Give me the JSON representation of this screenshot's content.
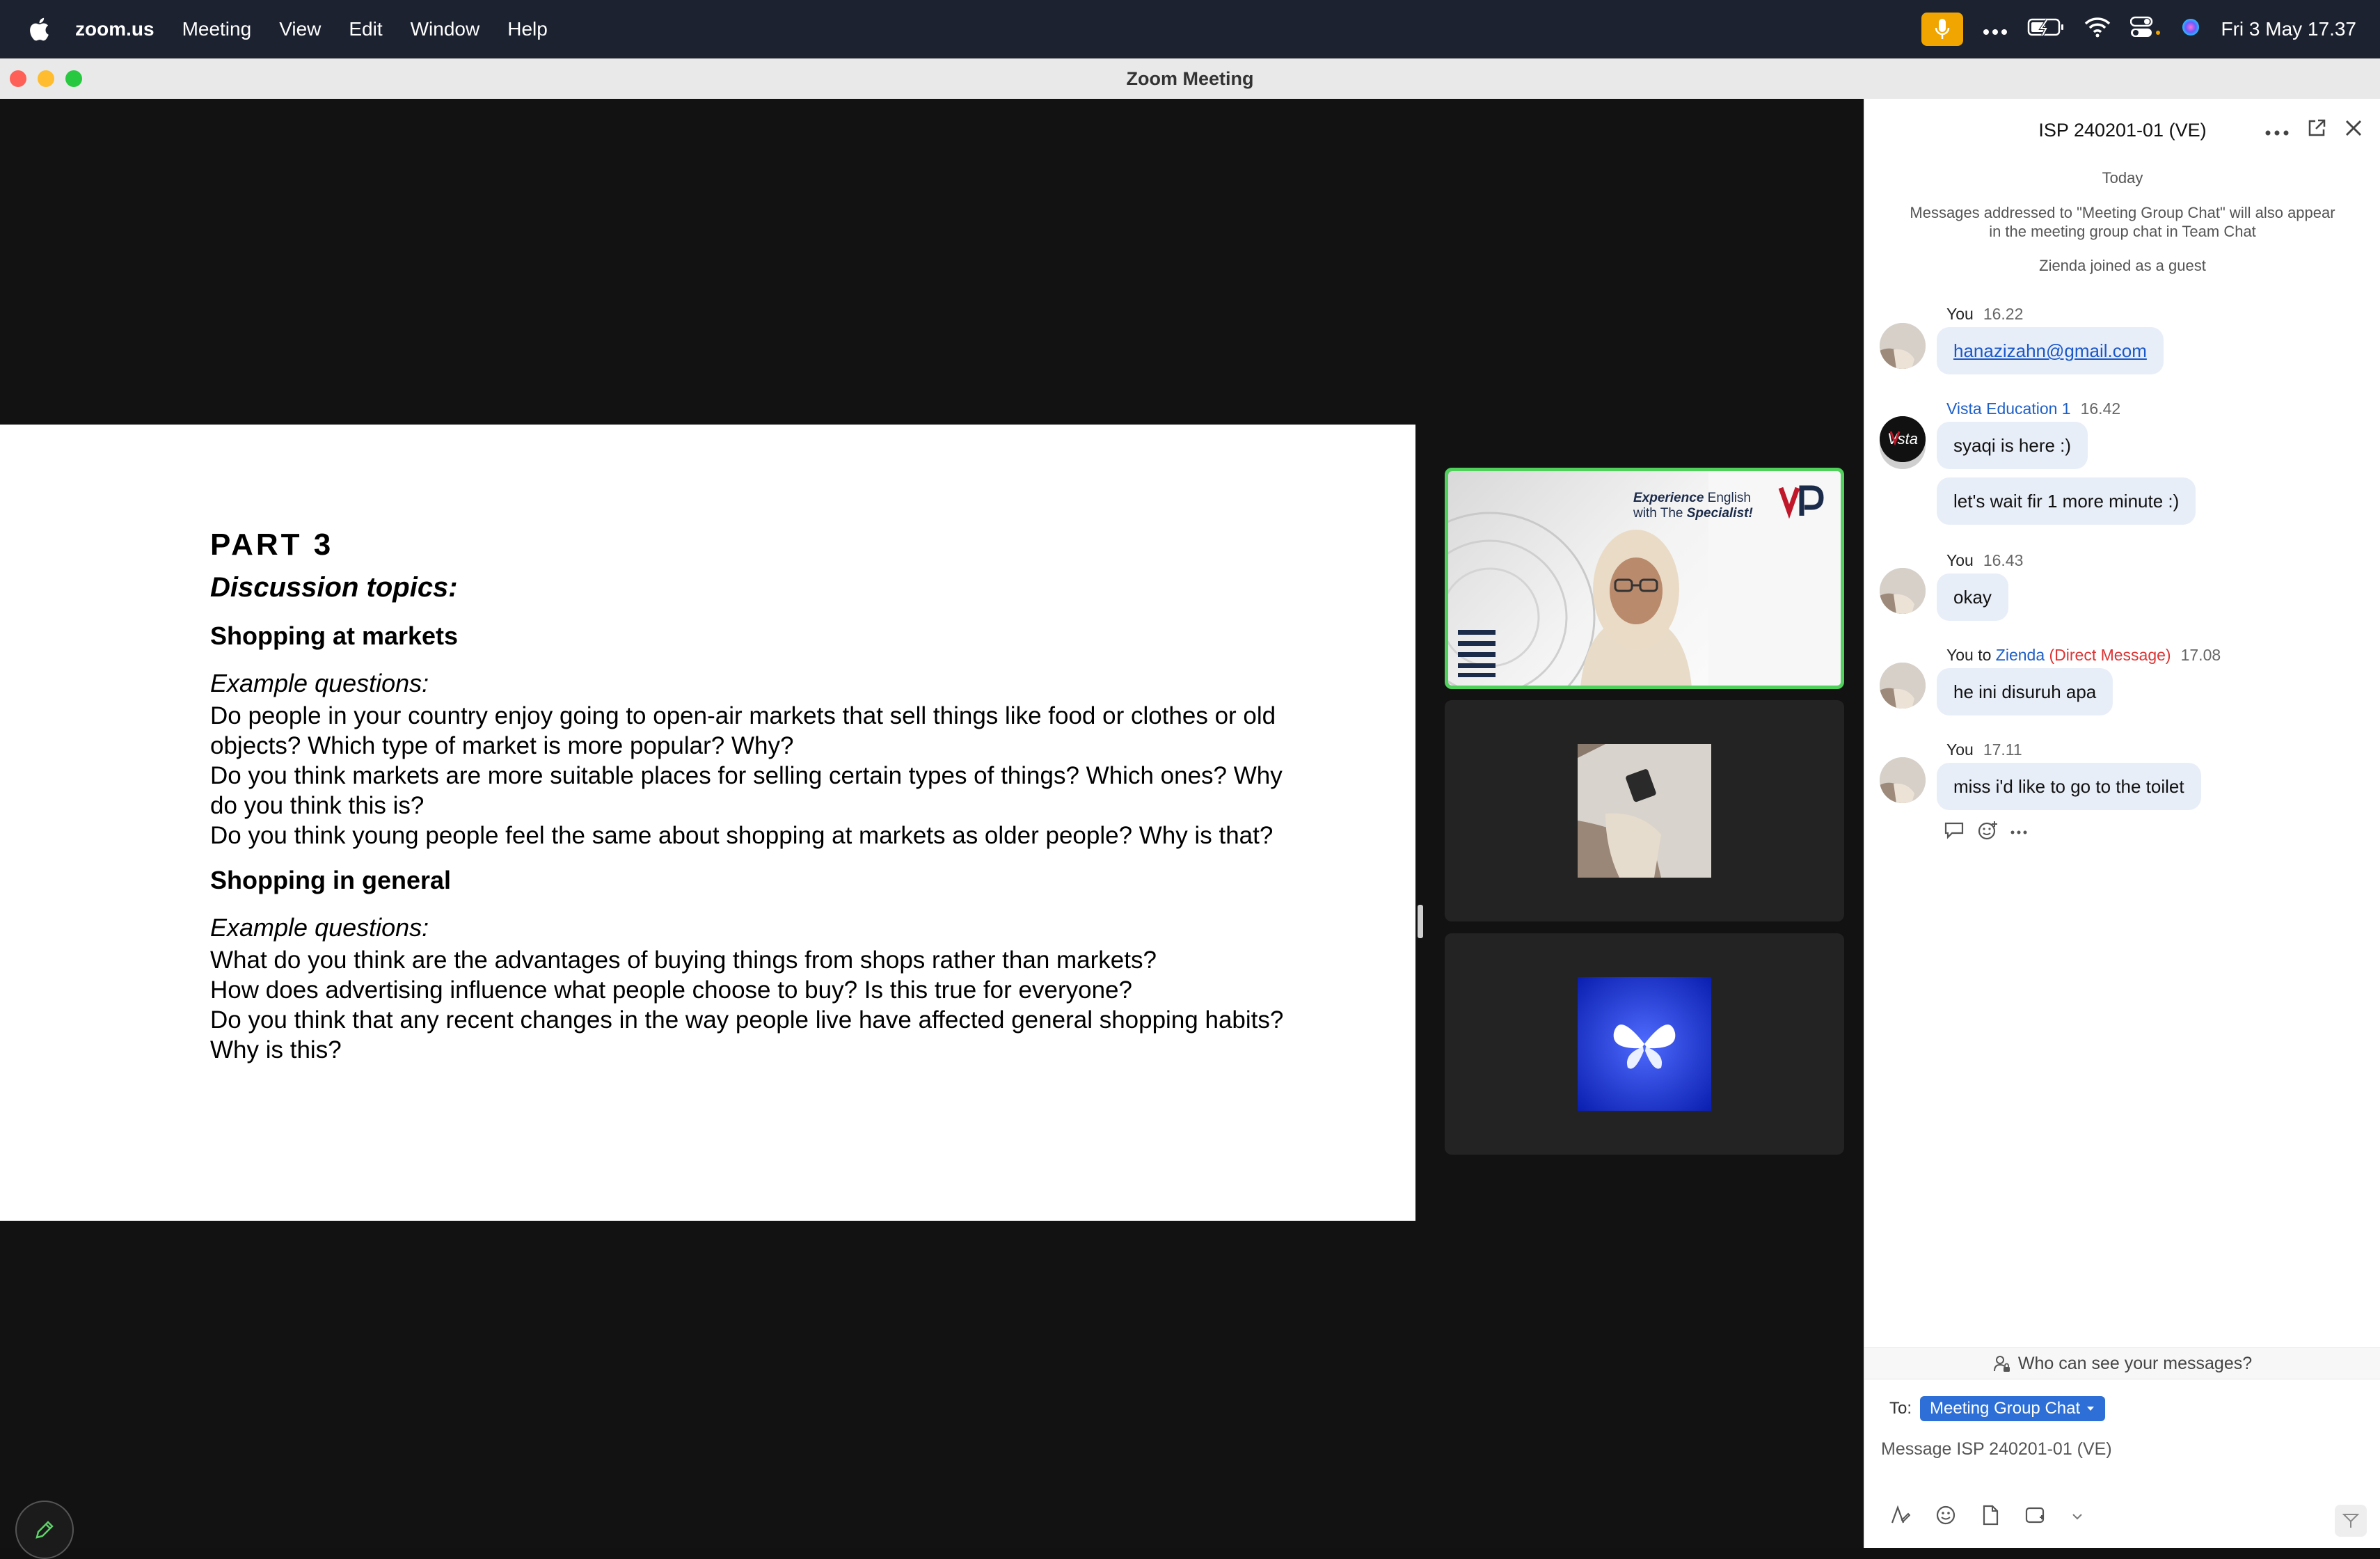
{
  "menubar": {
    "app_name": "zoom.us",
    "menus": [
      "Meeting",
      "View",
      "Edit",
      "Window",
      "Help"
    ],
    "clock": "Fri 3 May  17.37",
    "icons": [
      "apple-icon",
      "microphone-icon",
      "more-icon",
      "battery-icon",
      "wifi-icon",
      "control-center-icon",
      "siri-icon"
    ]
  },
  "window": {
    "title": "Zoom Meeting"
  },
  "slide": {
    "part": "PART 3",
    "topics_heading": "Discussion topics:",
    "sections": [
      {
        "heading": "Shopping at markets",
        "example_label": "Example questions:",
        "questions": [
          "Do people in your country enjoy going to open-air markets that sell things like food or clothes or old objects? Which type of market is more popular? Why?",
          "Do you think markets are more suitable places for selling certain types of things? Which ones? Why do you think this is?",
          "Do you think young people feel the same about shopping at markets as older people? Why is that?"
        ]
      },
      {
        "heading": "Shopping in general",
        "example_label": "Example questions:",
        "questions": [
          "What do you think are the advantages of buying things from shops rather than markets?",
          "How does advertising influence what people choose to buy? Is this true for everyone?",
          "Do you think that any recent changes in the way people live have affected general shopping habits? Why is this?"
        ]
      }
    ]
  },
  "video_tiles": {
    "tile1_brand_line1a": "Experience",
    "tile1_brand_line1b": " English",
    "tile1_brand_line2a": "with The ",
    "tile1_brand_line2b": "Specialist!",
    "accent": "#4fd15b"
  },
  "chat": {
    "title": "ISP 240201-01 (VE)",
    "date_label": "Today",
    "info_note": "Messages addressed to \"Meeting Group Chat\" will also appear in the meeting group chat in Team Chat",
    "join_note": "Zienda joined as a guest",
    "messages": [
      {
        "sender": "You",
        "time": "16.22",
        "text": "hanazizahn@gmail.com"
      },
      {
        "sender": "Vista Education 1",
        "time": "16.42",
        "text": "syaqi is here :)",
        "text2": "let's wait fir 1 more minute :)"
      },
      {
        "sender": "You",
        "time": "16.43",
        "text": "okay"
      },
      {
        "sender": "You",
        "to_word": " to ",
        "recipient": "Zienda",
        "dm_label": " (Direct Message)",
        "time": "17.08",
        "text": "he ini disuruh apa"
      },
      {
        "sender": "You",
        "time": "17.11",
        "text": "miss i'd like to go to the toilet"
      }
    ],
    "who_can_see": "Who can see your messages?",
    "to_label": "To:",
    "to_target": "Meeting Group Chat",
    "input_placeholder": "Message ISP 240201-01 (VE)",
    "accent": "#2d6fd6"
  }
}
